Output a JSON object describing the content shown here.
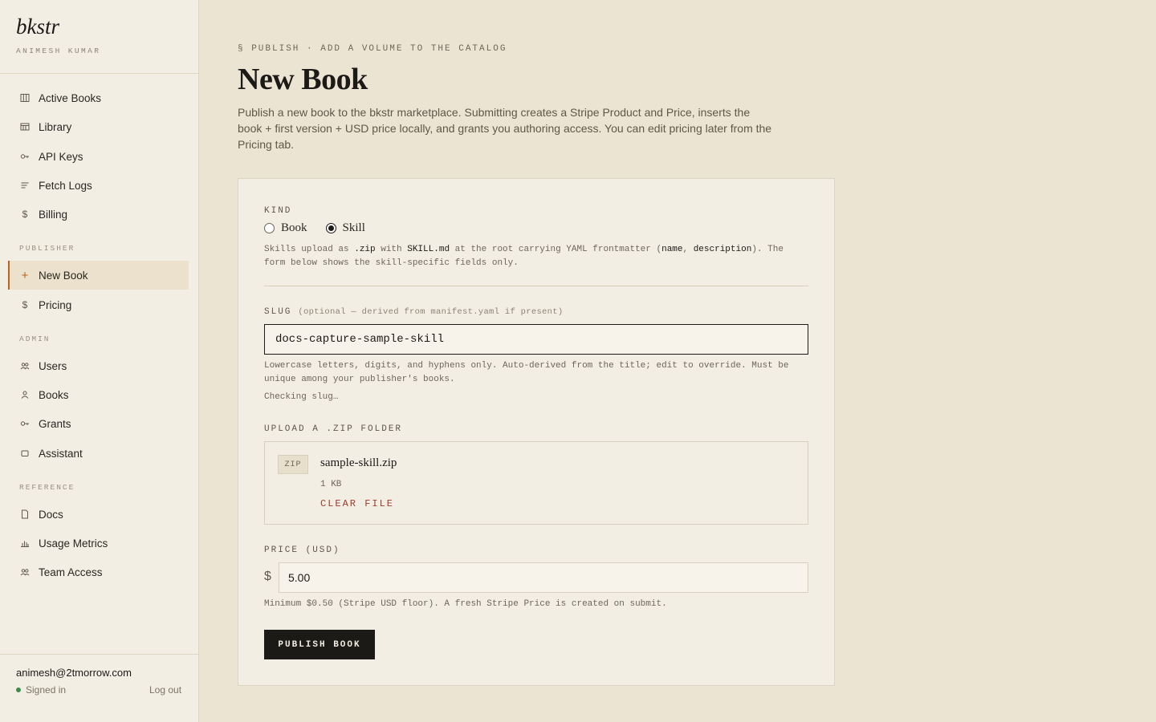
{
  "sidebar": {
    "brand": "bkstr",
    "user_name": "ANIMESH KUMAR",
    "main_items": [
      {
        "label": "Active Books",
        "icon": "columns-icon"
      },
      {
        "label": "Library",
        "icon": "library-icon"
      },
      {
        "label": "API Keys",
        "icon": "key-icon"
      },
      {
        "label": "Fetch Logs",
        "icon": "lines-icon"
      },
      {
        "label": "Billing",
        "icon": "dollar-icon"
      }
    ],
    "publisher_title": "PUBLISHER",
    "publisher_items": [
      {
        "label": "New Book",
        "icon": "plus-icon",
        "active": true
      },
      {
        "label": "Pricing",
        "icon": "dollar-icon"
      }
    ],
    "admin_title": "ADMIN",
    "admin_items": [
      {
        "label": "Users",
        "icon": "users-icon"
      },
      {
        "label": "Books",
        "icon": "person-icon"
      },
      {
        "label": "Grants",
        "icon": "key-icon"
      },
      {
        "label": "Assistant",
        "icon": "square-icon"
      }
    ],
    "reference_title": "REFERENCE",
    "reference_items": [
      {
        "label": "Docs",
        "icon": "document-icon"
      },
      {
        "label": "Usage Metrics",
        "icon": "bar-chart-icon"
      },
      {
        "label": "Team Access",
        "icon": "users-icon"
      }
    ],
    "footer": {
      "email": "animesh@2tmorrow.com",
      "status": "Signed in",
      "logout": "Log out"
    }
  },
  "header": {
    "eyebrow": "§ PUBLISH · ADD A VOLUME TO THE CATALOG",
    "title": "New Book",
    "intro": "Publish a new book to the bkstr marketplace. Submitting creates a Stripe Product and Price, inserts the book + first version + USD price locally, and grants you authoring access. You can edit pricing later from the Pricing tab."
  },
  "form": {
    "kind": {
      "label": "KIND",
      "options": [
        "Book",
        "Skill"
      ],
      "selected": "Skill",
      "help_pre": "Skills upload as ",
      "help_code1": ".zip",
      "help_mid1": " with ",
      "help_code2": "SKILL.md",
      "help_mid2": " at the root carrying YAML frontmatter (",
      "help_code3": "name",
      "help_mid3": ", ",
      "help_code4": "description",
      "help_post": "). The form below shows the skill-specific fields only."
    },
    "slug": {
      "label": "SLUG",
      "hint": "(optional — derived from manifest.yaml if present)",
      "value": "docs-capture-sample-skill",
      "help": "Lowercase letters, digits, and hyphens only. Auto-derived from the title; edit to override. Must be unique among your publisher's books.",
      "status": "Checking slug…"
    },
    "upload": {
      "label": "UPLOAD A .ZIP FOLDER",
      "badge": "ZIP",
      "file_name": "sample-skill.zip",
      "file_size": "1 KB",
      "clear": "CLEAR FILE"
    },
    "price": {
      "label": "PRICE (USD)",
      "currency": "$",
      "value": "5.00",
      "help": "Minimum $0.50 (Stripe USD floor). A fresh Stripe Price is created on submit."
    },
    "submit": "PUBLISH BOOK"
  }
}
